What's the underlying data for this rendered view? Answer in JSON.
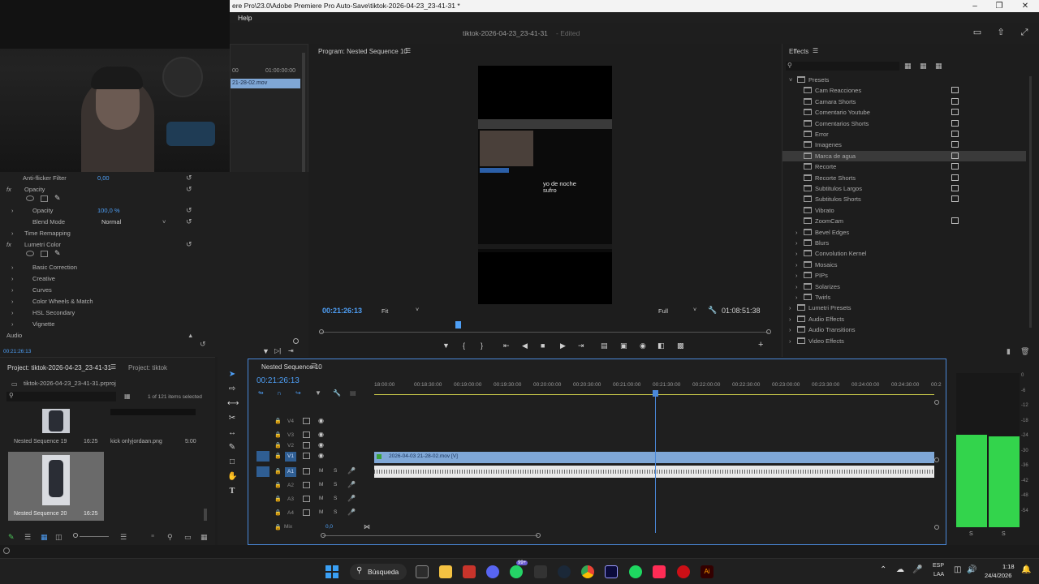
{
  "window": {
    "title": "ere Pro\\23.0\\Adobe Premiere Pro Auto-Save\\tiktok-2026-04-23_23-41-31 *",
    "menu_help": "Help",
    "doc_title": "tiktok-2026-04-23_23-41-31",
    "doc_status": "- Edited"
  },
  "source_panel": {
    "ruler_start": "00",
    "ruler_end": "01:00:00:00",
    "clip_name": "21-28-02.mov"
  },
  "effect_controls": {
    "rows": [
      {
        "label": "Anti-flicker Filter",
        "value": "0,00"
      },
      {
        "label": "Opacity",
        "value": ""
      },
      {
        "label": "Opacity",
        "value": "100,0 %"
      },
      {
        "label": "Blend Mode",
        "value": "Normal"
      },
      {
        "label": "Time Remapping",
        "value": ""
      },
      {
        "label": "Lumetri Color",
        "value": ""
      },
      {
        "label": "Basic Correction",
        "value": ""
      },
      {
        "label": "Creative",
        "value": ""
      },
      {
        "label": "Curves",
        "value": ""
      },
      {
        "label": "Color Wheels & Match",
        "value": ""
      },
      {
        "label": "HSL Secondary",
        "value": ""
      },
      {
        "label": "Vignette",
        "value": ""
      },
      {
        "label": "Audio",
        "value": ""
      }
    ],
    "timecode": "00:21:26:13"
  },
  "program_monitor": {
    "title": "Program: Nested Sequence 10",
    "timecode": "00:21:26:13",
    "fit": "Fit",
    "quality": "Full",
    "duration": "01:08:51:38",
    "caption_line1": "yo de noche",
    "caption_line2": "sufro"
  },
  "effects_panel": {
    "title": "Effects",
    "root": "Presets",
    "presets": [
      "Cam Reacciones",
      "Camara Shorts",
      "Comentario Youtube",
      "Comentarios Shorts",
      "Error",
      "Imagenes",
      "Marca de agua",
      "Recorte",
      "Recorte Shorts",
      "Subtitulos Largos",
      "Subtitulos Shorts",
      "Vibrato",
      "ZoomCam"
    ],
    "preset_badges": [
      true,
      true,
      true,
      true,
      true,
      true,
      true,
      true,
      true,
      true,
      true,
      false,
      true
    ],
    "subfolders": [
      "Bevel Edges",
      "Blurs",
      "Convolution Kernel",
      "Mosaics",
      "PIPs",
      "Solarizes",
      "Twirls"
    ],
    "categories": [
      "Lumetri Presets",
      "Audio Effects",
      "Audio Transitions",
      "Video Effects"
    ]
  },
  "project_panel": {
    "tab_project": "Project: tiktok-2026-04-23_23-41-31",
    "tab_project2": "Project: tiktok",
    "filename": "tiktok-2026-04-23_23-41-31.prproj",
    "selection_info": "1 of 121 items selected",
    "items": [
      {
        "name": "Nested Sequence 19",
        "duration": "16:25"
      },
      {
        "name": "kick onlyjordaan.png",
        "duration": "5:00"
      },
      {
        "name": "Nested Sequence 20",
        "duration": "16:25"
      }
    ]
  },
  "timeline": {
    "tab": "Nested Sequence 10",
    "timecode": "00:21:26:13",
    "ruler": [
      "18:00:00",
      "00:18:30:00",
      "00:19:00:00",
      "00:19:30:00",
      "00:20:00:00",
      "00:20:30:00",
      "00:21:00:00",
      "00:21:30:00",
      "00:22:00:00",
      "00:22:30:00",
      "00:23:00:00",
      "00:23:30:00",
      "00:24:00:00",
      "00:24:30:00",
      "00:2"
    ],
    "video_tracks": [
      "V4",
      "V3",
      "V2",
      "V1"
    ],
    "audio_tracks": [
      "A1",
      "A2",
      "A3",
      "A4"
    ],
    "mix_label": "Mix",
    "mix_value": "0,0",
    "clip_label": "2026-04-03 21-28-02.mov [V]",
    "track_mute": "M",
    "track_solo": "S"
  },
  "meter": {
    "scale": [
      "0",
      "-6",
      "-12",
      "-18",
      "-24",
      "-30",
      "-36",
      "-42",
      "-48",
      "-54"
    ],
    "footer_left": "S",
    "footer_right": "S",
    "level_left": 0.6,
    "level_right": 0.59
  },
  "taskbar": {
    "search_label": "Búsqueda",
    "lang_line1": "ESP",
    "lang_line2": "LAA",
    "time": "1:18",
    "date": "24/4/2026",
    "badge_count": "99+"
  },
  "colors": {
    "accent_blue": "#4e9ff6",
    "clip_blue": "#7fa7d6",
    "meter_green": "#33d44c",
    "playhead": "#4a88d9"
  }
}
